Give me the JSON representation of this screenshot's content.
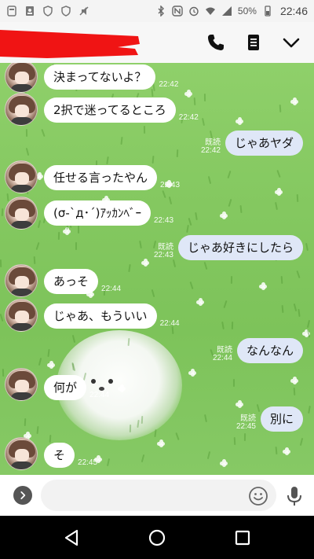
{
  "status_bar": {
    "battery": "50%",
    "time": "22:46",
    "left_icons": [
      "notification-icon",
      "contacts-icon",
      "shield-icon",
      "shield-icon",
      "mute-icon"
    ],
    "right_icons": [
      "bluetooth-icon",
      "nfc-icon",
      "alarm-icon",
      "wifi-icon",
      "signal-icon",
      "battery-icon"
    ]
  },
  "header": {
    "title_redacted": true,
    "actions": [
      "phone-icon",
      "menu-icon",
      "chevron-down-icon"
    ]
  },
  "messages": [
    {
      "side": "in",
      "text": "決まってないよ？",
      "time": "22:42",
      "avatar": true
    },
    {
      "side": "in",
      "text": "2択で迷ってるところ",
      "time": "22:42",
      "avatar": true
    },
    {
      "side": "out",
      "text": "じゃあヤダ",
      "time": "22:42",
      "read": "既読"
    },
    {
      "side": "in",
      "text": "任せる言ったやん",
      "time": "22:43",
      "avatar": true
    },
    {
      "side": "in",
      "text": "(σ-`д･´)ｱｯｶﾝﾍﾞｰ",
      "time": "22:43",
      "avatar": true
    },
    {
      "side": "out",
      "text": "じゃあ好きにしたら",
      "time": "22:43",
      "read": "既読"
    },
    {
      "side": "in",
      "text": "あっそ",
      "time": "22:44",
      "avatar": true
    },
    {
      "side": "in",
      "text": "じゃあ、もういい",
      "time": "22:44",
      "avatar": true
    },
    {
      "side": "out",
      "text": "なんなん",
      "time": "22:44",
      "read": "既読"
    },
    {
      "side": "in",
      "text": "何が",
      "time": "22:44",
      "avatar": true
    },
    {
      "side": "out",
      "text": "別に",
      "time": "22:45",
      "read": "既読"
    },
    {
      "side": "in",
      "text": "そ",
      "time": "22:45",
      "avatar": true
    }
  ],
  "input": {
    "value": "",
    "placeholder": ""
  },
  "colors": {
    "incoming_bubble": "#ffffff",
    "outgoing_bubble": "#dfe7f7",
    "background": "#84c860"
  }
}
